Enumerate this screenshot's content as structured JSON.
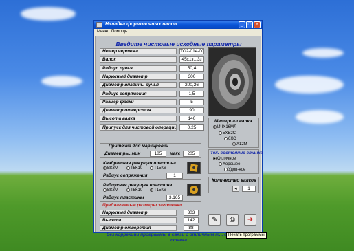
{
  "window": {
    "title": "Наладка формовочных валов",
    "menu": [
      "Меню",
      "Помощь"
    ],
    "controls": [
      "_",
      "□",
      "×"
    ]
  },
  "header": "Введите чистовые исходные параметры",
  "params": [
    {
      "label": "Номер чертежа",
      "value": "ТО2-014-001"
    },
    {
      "label": "Валок",
      "value": "45х1з...3з"
    },
    {
      "label": "Радиус ручья",
      "value": "50,4"
    },
    {
      "label": "Наружный диаметр",
      "value": "300"
    },
    {
      "label": "Диаметр впадины ручья",
      "value": "200,26"
    },
    {
      "label": "Радиус сопряжения",
      "value": "1,5"
    },
    {
      "label": "Размер фаски",
      "value": "5"
    },
    {
      "label": "Диаметр отверстия",
      "value": "90"
    },
    {
      "label": "Высота валка",
      "value": "140"
    },
    {
      "label": "Припуск для чистовой операции",
      "value": "0,25"
    }
  ],
  "marking": {
    "title": "Приточка для маркировки",
    "diam_label": "Диаметры,  мин",
    "min": "185",
    "max_label": "макс",
    "max": "205"
  },
  "square_plate": {
    "title": "Квадратная режущая пластина",
    "options": [
      "ВК3М",
      "Т5К10",
      "Т15К6"
    ],
    "selected": 0,
    "radius_label": "Радиус сопряжения",
    "radius": "1"
  },
  "round_plate": {
    "title": "Радиусная режущая пластина",
    "options": [
      "ВК3М",
      "Т5К10",
      "Т15К6"
    ],
    "selected": 2,
    "radius_label": "Радиус пластины",
    "radius": "3,165"
  },
  "material": {
    "title": "Материал валка",
    "options": [
      "ИЧХ16МЛ",
      "5ХВ2С",
      "6ХС",
      "Х12М"
    ],
    "selected": 0
  },
  "machine": {
    "title": "Тех. состояние станка",
    "options": [
      "Отличное",
      "Хорошее",
      "Удов-ное"
    ],
    "selected": 0
  },
  "rolls": {
    "label": "Количество валков",
    "value": "1"
  },
  "proposed": {
    "title": "Предлагаемые размеры заготовки",
    "rows": [
      {
        "label": "Наружный диаметр",
        "value": "303"
      },
      {
        "label": "Высота",
        "value": "142"
      },
      {
        "label": "Диаметр отверстия",
        "value": "88"
      }
    ]
  },
  "buttons": {
    "calc_icon": "edit-icon",
    "print_icon": "print-icon",
    "exit_icon": "exit-icon",
    "tooltip": "Печать программы"
  },
  "note": "Без коррекции программы в связи с отличным т... состоянием станка."
}
